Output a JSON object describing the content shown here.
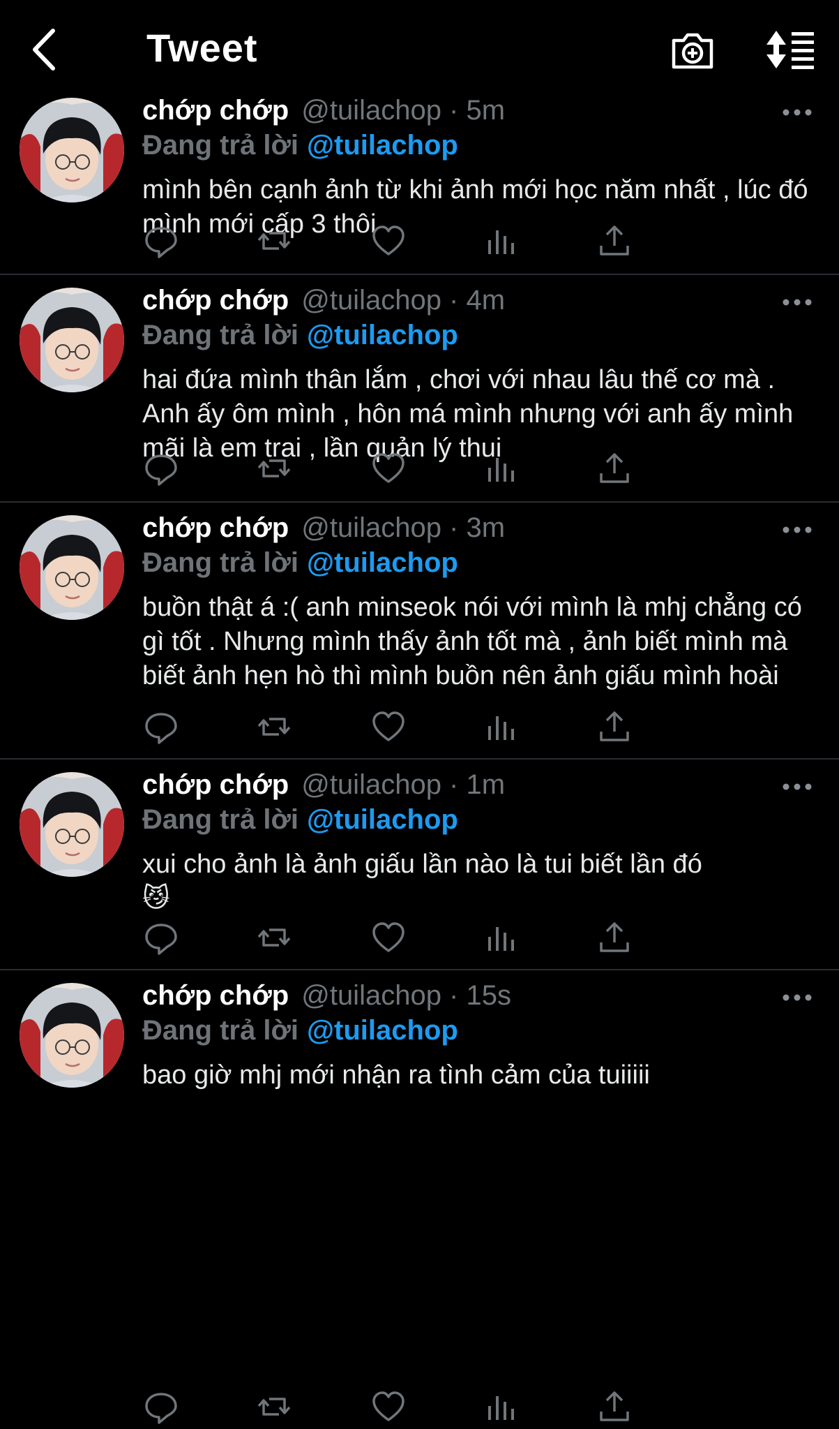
{
  "header": {
    "title": "Tweet",
    "back_icon": "back-arrow-icon",
    "camera_icon": "camera-add-icon",
    "sort_icon": "sort-icon"
  },
  "colors": {
    "background": "#000000",
    "text": "#e7e9ea",
    "muted": "#71767b",
    "accent": "#1d9bf0",
    "divider": "#2a2d31"
  },
  "tweets": [
    {
      "name": "chớp chớp",
      "handle": "@tuilachop · 5m",
      "reply_prefix": "Đang trả lời",
      "reply_to": "@tuilachop",
      "text": "mình bên cạnh ảnh từ khi ảnh mới học năm nhất , lúc đó mình mới cấp 3 thôi",
      "emoji": ""
    },
    {
      "name": "chớp chớp",
      "handle": "@tuilachop · 4m",
      "reply_prefix": "Đang trả lời",
      "reply_to": "@tuilachop",
      "text": "hai đứa mình thân lắm , chơi với nhau lâu thế cơ mà . Anh ấy ôm mình , hôn má mình nhưng với anh ấy mình mãi là em trai , lần quản lý thui",
      "emoji": ""
    },
    {
      "name": "chớp chớp",
      "handle": "@tuilachop · 3m",
      "reply_prefix": "Đang trả lời",
      "reply_to": "@tuilachop",
      "text": "buồn thật á :( anh minseok nói với mình là mhj chẳng có gì tốt . Nhưng mình thấy ảnh tốt mà , ảnh biết mình mà biết ảnh hẹn hò thì mình buồn nên ảnh giấu mình hoài",
      "emoji": ""
    },
    {
      "name": "chớp chớp",
      "handle": "@tuilachop · 1m",
      "reply_prefix": "Đang trả lời",
      "reply_to": "@tuilachop",
      "text": "xui cho ảnh là ảnh giấu lần nào là tui biết lần đó",
      "emoji": "😼"
    },
    {
      "name": "chớp chớp",
      "handle": "@tuilachop · 15s",
      "reply_prefix": "Đang trả lời",
      "reply_to": "@tuilachop",
      "text": "bao giờ mhj mới nhận ra tình cảm của tuiiiii",
      "emoji": ""
    }
  ]
}
